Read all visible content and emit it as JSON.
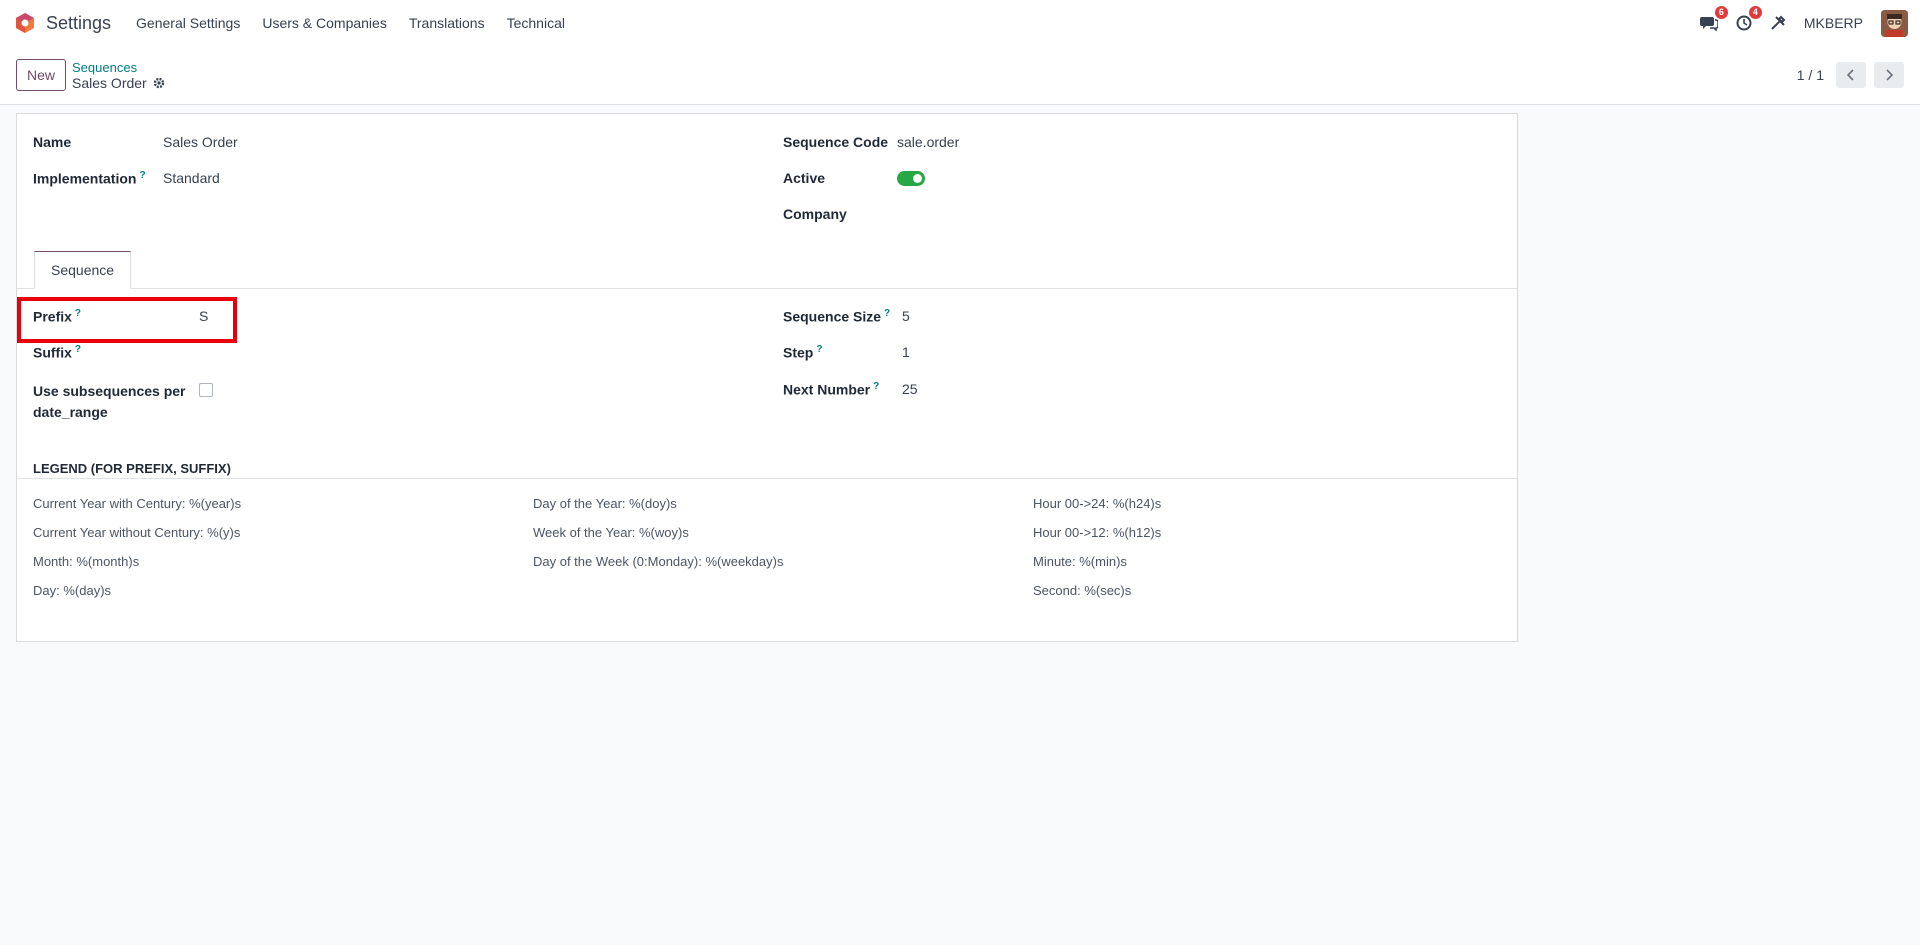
{
  "navbar": {
    "app_name": "Settings",
    "menu": [
      "General Settings",
      "Users & Companies",
      "Translations",
      "Technical"
    ],
    "messages_count": "6",
    "activities_count": "4",
    "company": "MKBERP"
  },
  "control_panel": {
    "new_label": "New",
    "breadcrumb_parent": "Sequences",
    "breadcrumb_current": "Sales Order",
    "pager_value": "1 / 1"
  },
  "form": {
    "name_label": "Name",
    "name_value": "Sales Order",
    "implementation_label": "Implementation",
    "implementation_value": "Standard",
    "sequence_code_label": "Sequence Code",
    "sequence_code_value": "sale.order",
    "active_label": "Active",
    "active_value": true,
    "company_label": "Company",
    "tab_label": "Sequence",
    "prefix_label": "Prefix",
    "prefix_value": "S",
    "suffix_label": "Suffix",
    "subseq_label_1": "Use subsequences per",
    "subseq_label_2": "date_range",
    "sequence_size_label": "Sequence Size",
    "sequence_size_value": "5",
    "step_label": "Step",
    "step_value": "1",
    "next_number_label": "Next Number",
    "next_number_value": "25",
    "help_mark": "?"
  },
  "legend": {
    "title": "LEGEND (FOR PREFIX, SUFFIX)",
    "col1": [
      "Current Year with Century: %(year)s",
      "Current Year without Century: %(y)s",
      "Month: %(month)s",
      "Day: %(day)s"
    ],
    "col2": [
      "Day of the Year: %(doy)s",
      "Week of the Year: %(woy)s",
      "Day of the Week (0:Monday): %(weekday)s"
    ],
    "col3": [
      "Hour 00->24: %(h24)s",
      "Hour 00->12: %(h12)s",
      "Minute: %(min)s",
      "Second: %(sec)s"
    ]
  },
  "colors": {
    "brand": "#714b67",
    "link": "#017e84",
    "toggle_on": "#28a745",
    "highlight": "#e8000b",
    "badge": "#e33b3b"
  }
}
